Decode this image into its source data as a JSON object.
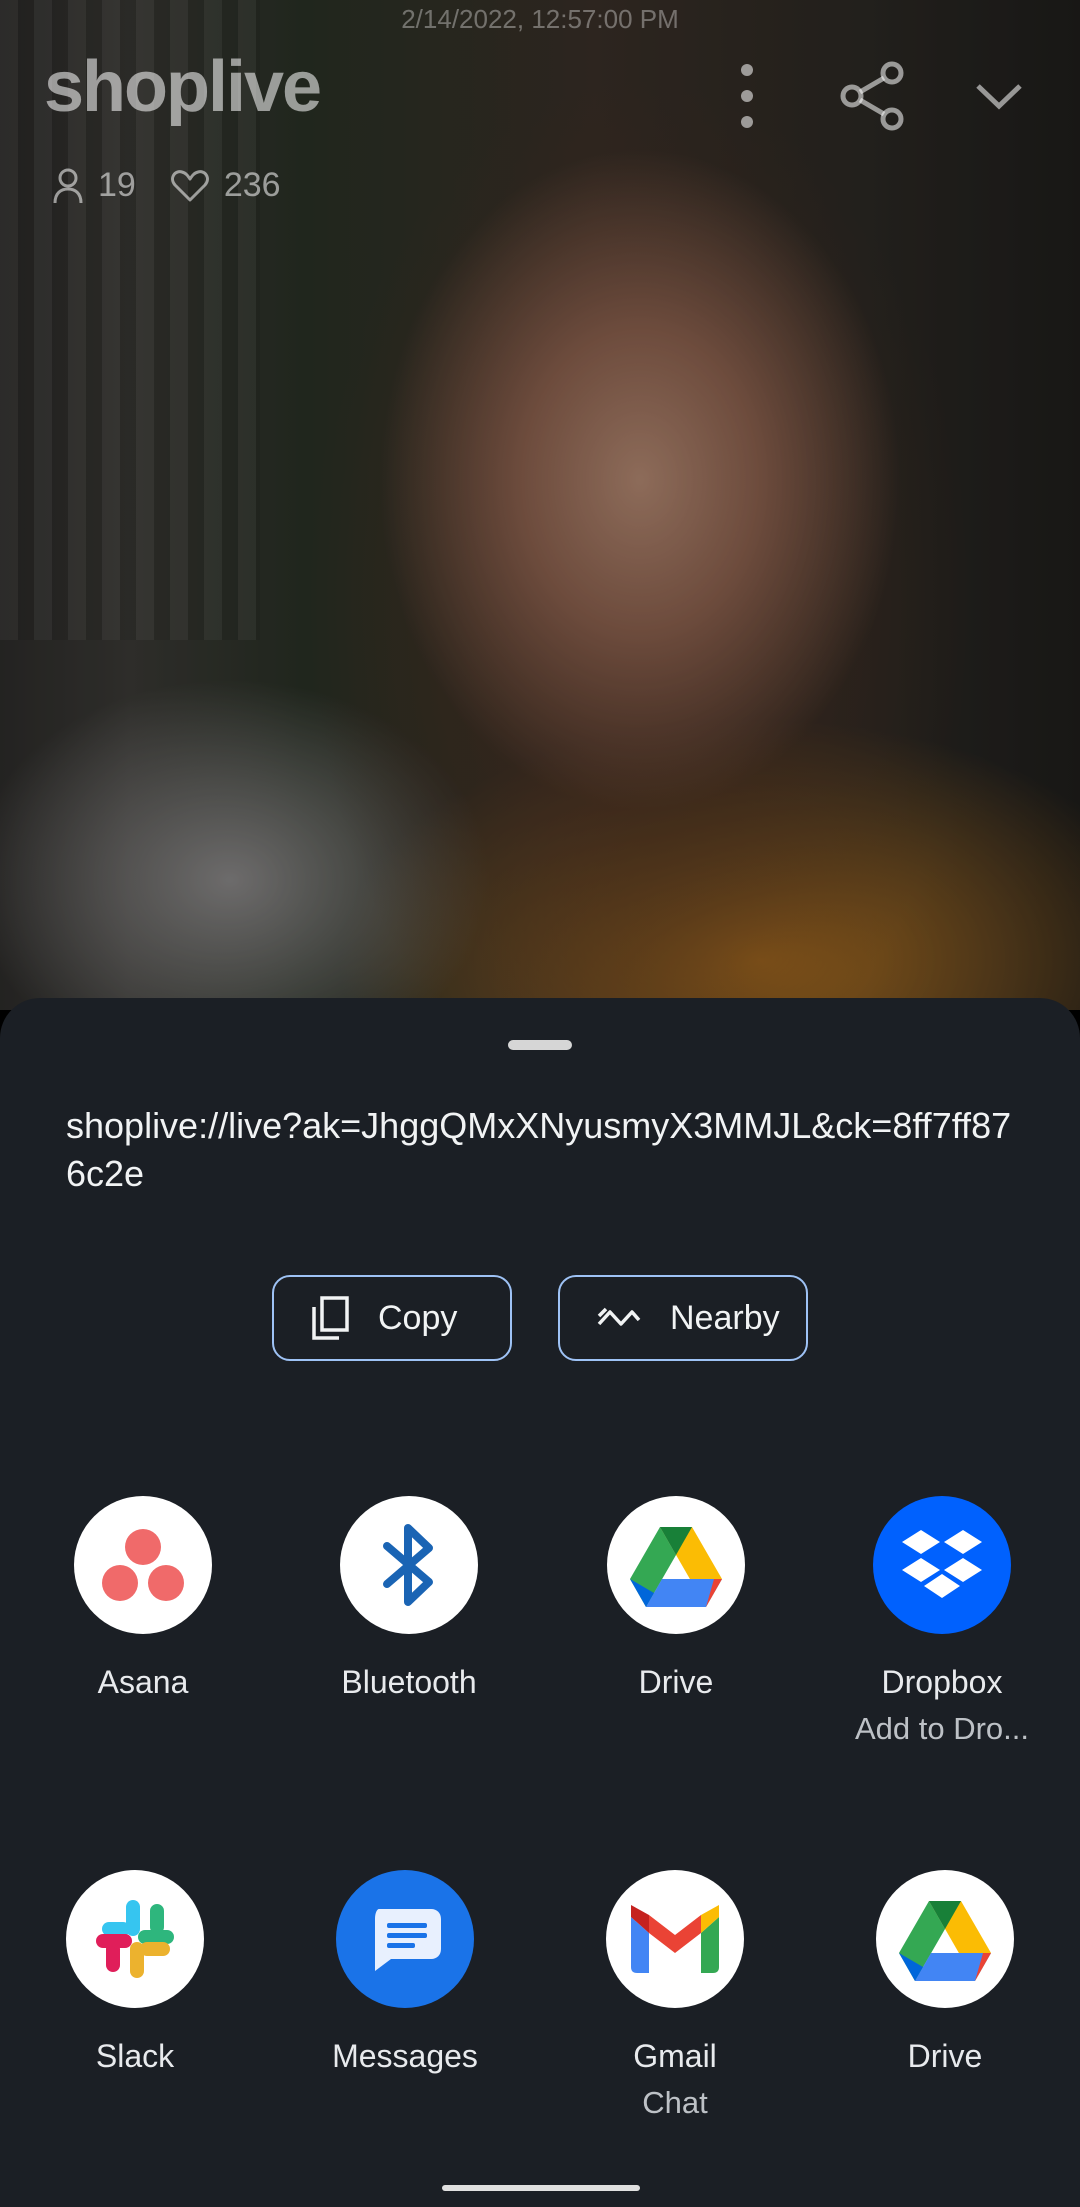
{
  "status": {
    "timestamp": "2/14/2022, 12:57:00 PM"
  },
  "player": {
    "brand": "shoplive",
    "viewers": "19",
    "likes": "236",
    "icons": [
      "more-vertical-icon",
      "share-icon",
      "chevron-down-icon"
    ]
  },
  "share_sheet": {
    "url": "shoplive://live?ak=JhggQMxXNyusmyX3MMJL&ck=8ff7ff876c2e",
    "actions": {
      "copy": "Copy",
      "nearby": "Nearby"
    },
    "apps_row1": [
      {
        "label": "Asana",
        "sub": ""
      },
      {
        "label": "Bluetooth",
        "sub": ""
      },
      {
        "label": "Drive",
        "sub": ""
      },
      {
        "label": "Dropbox",
        "sub": "Add to Dro..."
      }
    ],
    "apps_row2": [
      {
        "label": "Slack",
        "sub": ""
      },
      {
        "label": "Messages",
        "sub": ""
      },
      {
        "label": "Gmail",
        "sub": "Chat"
      },
      {
        "label": "Drive",
        "sub": ""
      }
    ]
  },
  "colors": {
    "sheet_bg": "#1b1f25",
    "chip_border": "#9ec2f5",
    "asana": "#f06a6a",
    "bluetooth": "#1a64b4",
    "dropbox": "#0061fe",
    "messages": "#1a73e8"
  }
}
